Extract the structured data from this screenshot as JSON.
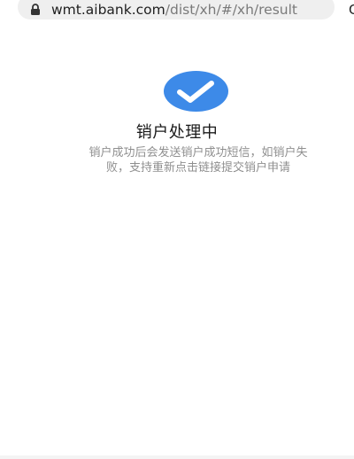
{
  "browser": {
    "url_domain": "wmt.aibank.com",
    "url_path": "/dist/xh/#/xh/result",
    "edge_fragment": "C",
    "icons": {
      "lock": "lock-icon"
    }
  },
  "result": {
    "icon": "check-icon",
    "accent_color": "#3d8ae8",
    "title": "销户处理中",
    "description": "销户成功后会发送销户成功短信，如销户失败，支持重新点击链接提交销户申请"
  }
}
